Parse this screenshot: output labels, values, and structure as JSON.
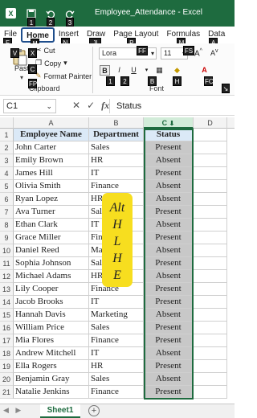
{
  "titlebar": {
    "title": "Employee_Attendance - Excel",
    "keytips": [
      "1",
      "2",
      "3"
    ],
    "bg": "#1e6b3f"
  },
  "tabs": [
    {
      "label": "File",
      "keytip": "F"
    },
    {
      "label": "Home",
      "keytip": "H",
      "active": true
    },
    {
      "label": "Insert",
      "keytip": "N"
    },
    {
      "label": "Draw",
      "keytip": "JI"
    },
    {
      "label": "Page Layout",
      "keytip": "P"
    },
    {
      "label": "Formulas",
      "keytip": "M"
    },
    {
      "label": "Data",
      "keytip": "A"
    }
  ],
  "ribbon": {
    "paste": "Paste",
    "cut": "Cut",
    "copy": "Copy",
    "format_painter": "Format Painter",
    "clipboard_group": "Clipboard",
    "font_name": "Lora",
    "font_size": "11",
    "font_group": "Font",
    "bold": "B",
    "italic": "I",
    "underline": "U"
  },
  "formula_bar": {
    "cell_ref": "C1",
    "fx": "fx",
    "value": "Status"
  },
  "columns": [
    "A",
    "B",
    "C",
    "D"
  ],
  "headers": {
    "name": "Employee Name",
    "dept": "Department",
    "status": "Status"
  },
  "rows": [
    {
      "num": "2",
      "name": "John Carter",
      "dept": "Sales",
      "status": "Present"
    },
    {
      "num": "3",
      "name": "Emily Brown",
      "dept": "HR",
      "status": "Absent"
    },
    {
      "num": "4",
      "name": "James Hill",
      "dept": "IT",
      "status": "Present"
    },
    {
      "num": "5",
      "name": "Olivia Smith",
      "dept": "Finance",
      "status": "Absent"
    },
    {
      "num": "6",
      "name": "Ryan Lopez",
      "dept": "HR",
      "status": "Absent"
    },
    {
      "num": "7",
      "name": "Ava Turner",
      "dept": "Sales",
      "status": "Present"
    },
    {
      "num": "8",
      "name": "Ethan Clark",
      "dept": "IT",
      "status": "Absent"
    },
    {
      "num": "9",
      "name": "Grace Miller",
      "dept": "Finance",
      "status": "Present"
    },
    {
      "num": "10",
      "name": "Daniel Reed",
      "dept": "Marketing",
      "status": "Absent"
    },
    {
      "num": "11",
      "name": "Sophia Johnson",
      "dept": "Sales",
      "status": "Present"
    },
    {
      "num": "12",
      "name": "Michael Adams",
      "dept": "HR",
      "status": "Absent"
    },
    {
      "num": "13",
      "name": "Lily Cooper",
      "dept": "Finance",
      "status": "Present"
    },
    {
      "num": "14",
      "name": "Jacob Brooks",
      "dept": "IT",
      "status": "Present"
    },
    {
      "num": "15",
      "name": "Hannah Davis",
      "dept": "Marketing",
      "status": "Absent"
    },
    {
      "num": "16",
      "name": "William Price",
      "dept": "Sales",
      "status": "Present"
    },
    {
      "num": "17",
      "name": "Mia Flores",
      "dept": "Finance",
      "status": "Present"
    },
    {
      "num": "18",
      "name": "Andrew Mitchell",
      "dept": "IT",
      "status": "Absent"
    },
    {
      "num": "19",
      "name": "Ella Rogers",
      "dept": "HR",
      "status": "Present"
    },
    {
      "num": "20",
      "name": "Benjamin Gray",
      "dept": "Sales",
      "status": "Absent"
    },
    {
      "num": "21",
      "name": "Natalie Jenkins",
      "dept": "Finance",
      "status": "Present"
    }
  ],
  "overlay": [
    "Alt",
    "H",
    "L",
    "H",
    "E"
  ],
  "sheet_tab": "Sheet1",
  "colors": {
    "accent": "#1e6b3f",
    "overlay": "#f7de1f",
    "status_fill": "#c8c8c8"
  }
}
